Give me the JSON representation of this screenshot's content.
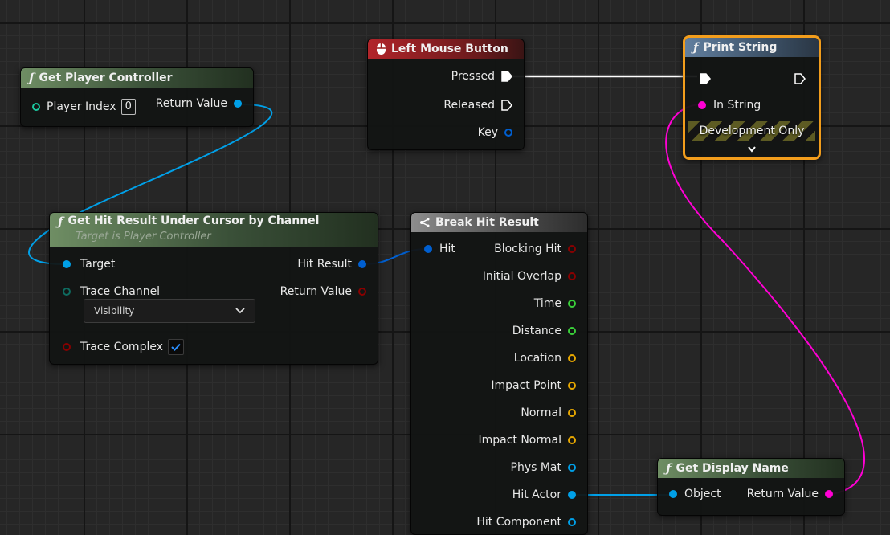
{
  "colors": {
    "exec": "#ffffff",
    "object": "#00a0e8",
    "struct": "#005fd0",
    "bool": "#8a0000",
    "float": "#3ad13a",
    "vector": "#e8a800",
    "string": "#ff00d4",
    "int": "#1cc8a0",
    "byte": "#0e6b60",
    "selection": "#f29d1c"
  },
  "nodes": {
    "get_player_controller": {
      "title": "Get Player Controller",
      "icon": "function-icon",
      "player_index_label": "Player Index",
      "player_index_value": "0",
      "return_label": "Return Value"
    },
    "left_mouse_button": {
      "title": "Left Mouse Button",
      "icon": "mouse-icon",
      "pressed_label": "Pressed",
      "released_label": "Released",
      "key_label": "Key"
    },
    "print_string": {
      "title": "Print String",
      "icon": "function-icon",
      "in_string_label": "In String",
      "dev_only_label": "Development Only",
      "expand_icon": "chevron-down-icon"
    },
    "get_hit_result": {
      "title": "Get Hit Result Under Cursor by Channel",
      "subtitle": "Target is Player Controller",
      "icon": "function-icon",
      "target_label": "Target",
      "trace_channel_label": "Trace Channel",
      "trace_channel_value": "Visibility",
      "trace_complex_label": "Trace Complex",
      "trace_complex_checked": true,
      "hit_result_label": "Hit Result",
      "return_label": "Return Value"
    },
    "break_hit_result": {
      "title": "Break Hit Result",
      "icon": "break-struct-icon",
      "hit_label": "Hit",
      "outputs": [
        {
          "label": "Blocking Hit",
          "type": "bool"
        },
        {
          "label": "Initial Overlap",
          "type": "bool"
        },
        {
          "label": "Time",
          "type": "float"
        },
        {
          "label": "Distance",
          "type": "float"
        },
        {
          "label": "Location",
          "type": "vector"
        },
        {
          "label": "Impact Point",
          "type": "vector"
        },
        {
          "label": "Normal",
          "type": "vector"
        },
        {
          "label": "Impact Normal",
          "type": "vector"
        },
        {
          "label": "Phys Mat",
          "type": "object"
        },
        {
          "label": "Hit Actor",
          "type": "object"
        },
        {
          "label": "Hit Component",
          "type": "object"
        }
      ]
    },
    "get_display_name": {
      "title": "Get Display Name",
      "icon": "function-icon",
      "object_label": "Object",
      "return_label": "Return Value"
    }
  }
}
